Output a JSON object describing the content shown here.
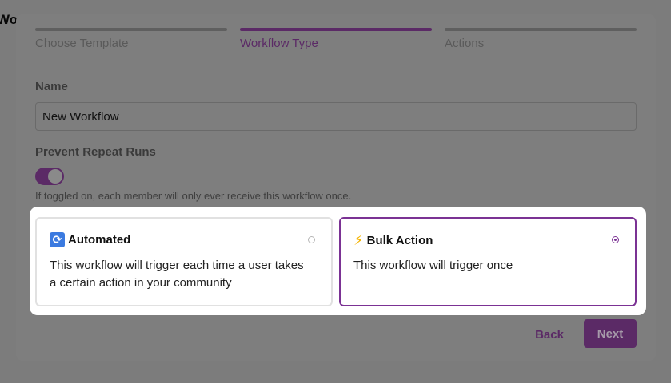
{
  "background": {
    "title": "Wo"
  },
  "stepper": {
    "steps": [
      {
        "label": "Choose Template"
      },
      {
        "label": "Workflow Type"
      },
      {
        "label": "Actions"
      }
    ],
    "active_index": 1
  },
  "form": {
    "name_label": "Name",
    "name_value": "New Workflow",
    "prevent_repeat_label": "Prevent Repeat Runs",
    "prevent_repeat_on": true,
    "prevent_repeat_helper": "If toggled on, each member will only ever receive this workflow once."
  },
  "options": [
    {
      "icon": "repeat-arrows-icon",
      "title": "Automated",
      "description": "This workflow will trigger each time a user takes a certain action in your community",
      "selected": false
    },
    {
      "icon": "lightning-bolt-icon",
      "title": "Bulk Action",
      "description": "This workflow will trigger once",
      "selected": true
    }
  ],
  "footer": {
    "back_label": "Back",
    "next_label": "Next"
  },
  "colors": {
    "accent": "#7b3294",
    "accent_dimmed": "#5b2a66"
  }
}
